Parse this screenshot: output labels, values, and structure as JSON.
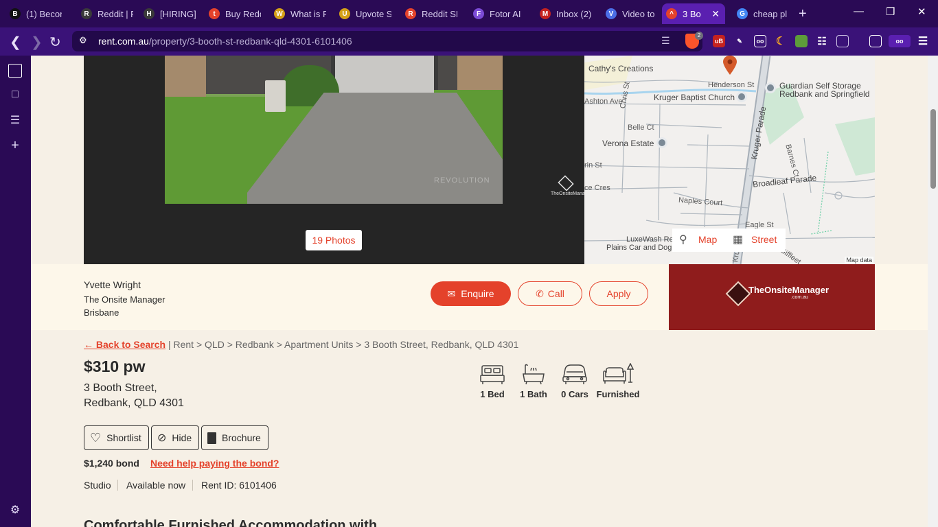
{
  "browser": {
    "tabs": [
      {
        "title": "(1) Becon",
        "color": "#111111",
        "glyph": "B"
      },
      {
        "title": "Reddit | F",
        "color": "#3a3a3a",
        "glyph": "R"
      },
      {
        "title": "[HIRING]",
        "color": "#3a3a3a",
        "glyph": "H"
      },
      {
        "title": "Buy Redd",
        "color": "#e4422b",
        "glyph": "t"
      },
      {
        "title": "What is R",
        "color": "#d4a017",
        "glyph": "W"
      },
      {
        "title": "Upvote S",
        "color": "#d4a017",
        "glyph": "U"
      },
      {
        "title": "Reddit SE",
        "color": "#e4422b",
        "glyph": "R"
      },
      {
        "title": "Fotor AI",
        "color": "#7b4bd6",
        "glyph": "F"
      },
      {
        "title": "Inbox (2)",
        "color": "#c5221f",
        "glyph": "M"
      },
      {
        "title": "Video to",
        "color": "#4b6ee6",
        "glyph": "V"
      },
      {
        "title": "3 Bo",
        "color": "#e4422b",
        "glyph": "^"
      },
      {
        "title": "cheap pl",
        "color": "#4285f4",
        "glyph": "G"
      }
    ],
    "active_tab_index": 10,
    "new_tab_label": "+",
    "url_domain": "rent.com.au",
    "url_path": "/property/3-booth-st-redbank-qld-4301-6101406",
    "shield_count": "2"
  },
  "gallery": {
    "photos_button": "19 Photos",
    "watermark": "REVOLUTION",
    "logo_text": "TheOnsiteManager"
  },
  "map": {
    "labels": {
      "cathys": "Cathy's Creations",
      "henderson": "Henderson St",
      "guardian1": "Guardian Self Storage",
      "guardian2": "Redbank and Springfield",
      "ashton": "Ashton Ave",
      "kruger_church": "Kruger Baptist Church",
      "chris": "Chris St",
      "kruger_parade": "Kruger Parade",
      "belle": "Belle Ct",
      "barnes": "Barnes Ct",
      "verona": "Verona Estate",
      "rin": "rin St",
      "broadleaf": "Broadleaf Parade",
      "ce_cres": "ce Cres",
      "naples": "Naples Court",
      "luxewash1": "LuxeWash Re",
      "luxewash2": "Plains Car and Dog",
      "eagle": "Eagle St",
      "siffleet": "Siffleet",
      "kruger_bottom": "Kruger"
    },
    "map_button": "Map",
    "street_button": "Street",
    "attribution": "Map data"
  },
  "agent": {
    "name": "Yvette Wright",
    "agency": "The Onsite Manager",
    "city": "Brisbane",
    "enquire": "Enquire",
    "call": "Call",
    "apply": "Apply",
    "logo_text": "TheOnsiteManager",
    "logo_sub": ".com.au"
  },
  "breadcrumb": {
    "back": "← Back to Search",
    "items": [
      "Rent",
      "QLD",
      "Redbank",
      "Apartment Units",
      "3 Booth Street, Redbank, QLD 4301"
    ]
  },
  "listing": {
    "price": "$310 pw",
    "address_line1": "3 Booth Street,",
    "address_line2": "Redbank, QLD 4301",
    "features": [
      {
        "label": "1 Bed",
        "icon": "bed-icon"
      },
      {
        "label": "1 Bath",
        "icon": "bath-icon"
      },
      {
        "label": "0 Cars",
        "icon": "car-icon"
      },
      {
        "label": "Furnished",
        "icon": "sofa-icon"
      }
    ],
    "shortlist": "Shortlist",
    "hide": "Hide",
    "brochure": "Brochure",
    "bond": "$1,240 bond",
    "bond_help": "Need help paying the bond?",
    "type": "Studio",
    "availability": "Available now",
    "rent_id": "Rent ID: 6101406",
    "headline": "Comfortable Furnished Accommodation with"
  },
  "colors": {
    "accent": "#e4422b",
    "browser_bg": "#2a0a55",
    "page_bg": "#f6f0e6",
    "agency_logo_bg": "#8f1c1c"
  }
}
